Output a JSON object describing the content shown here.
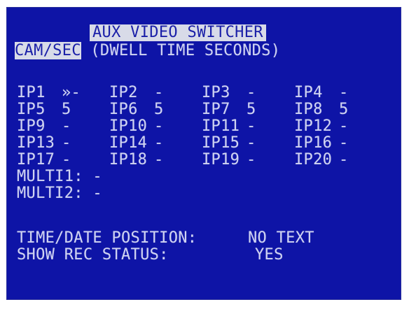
{
  "screen": {
    "title": "AUX VIDEO SWITCHER",
    "mode_selected": "CAM/SEC",
    "mode_rest": " (DWELL TIME SECONDS)"
  },
  "cameras": [
    {
      "label": "IP1",
      "value": "»-"
    },
    {
      "label": "IP2",
      "value": "-"
    },
    {
      "label": "IP3",
      "value": "-"
    },
    {
      "label": "IP4",
      "value": "-"
    },
    {
      "label": "IP5",
      "value": "5"
    },
    {
      "label": "IP6",
      "value": "5"
    },
    {
      "label": "IP7",
      "value": "5"
    },
    {
      "label": "IP8",
      "value": "5"
    },
    {
      "label": "IP9",
      "value": "-"
    },
    {
      "label": "IP10",
      "value": "-"
    },
    {
      "label": "IP11",
      "value": "-"
    },
    {
      "label": "IP12",
      "value": "-"
    },
    {
      "label": "IP13",
      "value": "-"
    },
    {
      "label": "IP14",
      "value": "-"
    },
    {
      "label": "IP15",
      "value": "-"
    },
    {
      "label": "IP16",
      "value": "-"
    },
    {
      "label": "IP17",
      "value": "-"
    },
    {
      "label": "IP18",
      "value": "-"
    },
    {
      "label": "IP19",
      "value": "-"
    },
    {
      "label": "IP20",
      "value": "-"
    }
  ],
  "multi": [
    {
      "label": "MULTI1:",
      "value": "-"
    },
    {
      "label": "MULTI2:",
      "value": "-"
    }
  ],
  "settings": {
    "time_date_label": "TIME/DATE POSITION:",
    "time_date_value": "NO TEXT",
    "rec_status_label": "SHOW REC STATUS:",
    "rec_status_value": "YES"
  },
  "colors": {
    "background": "#0e14a6",
    "text": "#cfd3f2",
    "highlight_bg": "#d8dbe8",
    "highlight_text": "#1a1fa8"
  }
}
